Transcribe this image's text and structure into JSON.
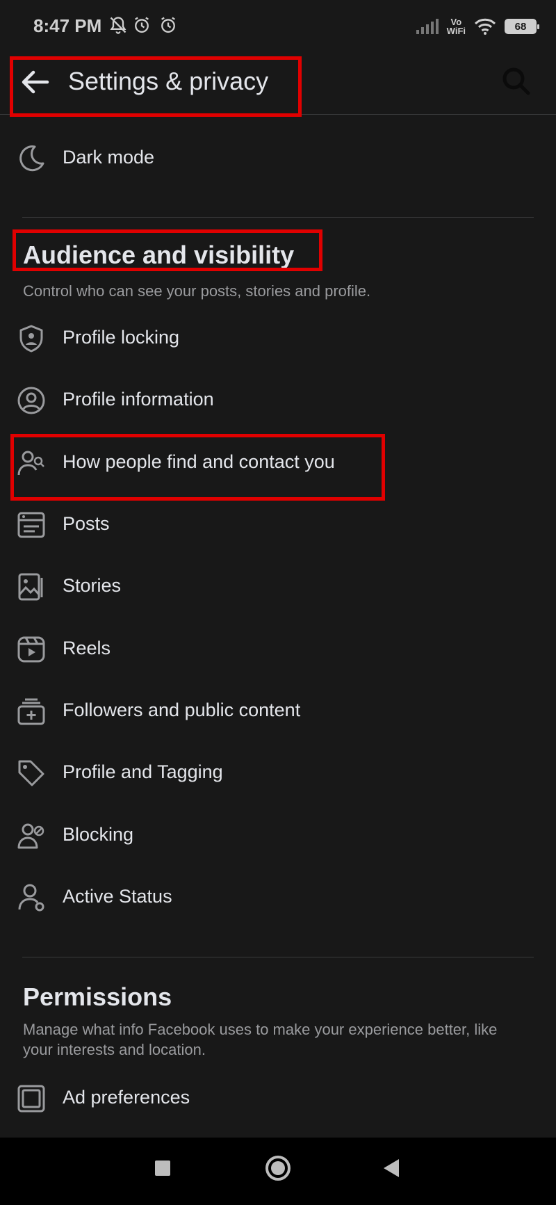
{
  "status_bar": {
    "time": "8:47 PM",
    "network_label": "Vo\nWiFi",
    "battery": "68"
  },
  "header": {
    "title": "Settings & privacy"
  },
  "top_items": [
    {
      "label": "Dark mode",
      "icon": "moon-icon"
    }
  ],
  "audience": {
    "title": "Audience and visibility",
    "description": "Control who can see your posts, stories and profile.",
    "items": [
      {
        "label": "Profile locking",
        "icon": "shield-person-icon"
      },
      {
        "label": "Profile information",
        "icon": "person-circle-icon"
      },
      {
        "label": "How people find and contact you",
        "icon": "person-search-icon"
      },
      {
        "label": "Posts",
        "icon": "posts-icon"
      },
      {
        "label": "Stories",
        "icon": "stories-icon"
      },
      {
        "label": "Reels",
        "icon": "reels-icon"
      },
      {
        "label": "Followers and public content",
        "icon": "followers-icon"
      },
      {
        "label": "Profile and Tagging",
        "icon": "tag-icon"
      },
      {
        "label": "Blocking",
        "icon": "blocking-icon"
      },
      {
        "label": "Active Status",
        "icon": "active-status-icon"
      }
    ]
  },
  "permissions": {
    "title": "Permissions",
    "description": "Manage what info Facebook uses to make your experience better, like your interests and location.",
    "items": [
      {
        "label": "Ad preferences",
        "icon": "ad-preferences-icon"
      }
    ]
  },
  "colors": {
    "background": "#181818",
    "text": "#e4e6eb",
    "secondary_text": "#9a9b9e",
    "highlight": "#e00000"
  }
}
